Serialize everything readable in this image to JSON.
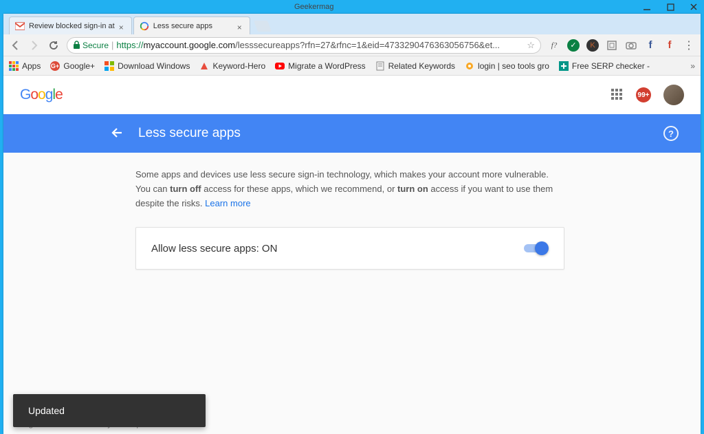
{
  "window": {
    "title": "Geekermag"
  },
  "tabs": [
    {
      "label": "Review blocked sign-in at",
      "favicon": "gmail"
    },
    {
      "label": "Less secure apps",
      "favicon": "google"
    }
  ],
  "address": {
    "secure_label": "Secure",
    "protocol": "https://",
    "domain": "myaccount.google.com",
    "path": "/lesssecureapps?rfn=27&rfnc=1&eid=4733290476363056756&et..."
  },
  "bookmarks": [
    {
      "label": "Apps",
      "icon": "apps"
    },
    {
      "label": "Google+",
      "icon": "gplus"
    },
    {
      "label": "Download Windows",
      "icon": "win"
    },
    {
      "label": "Keyword-Hero",
      "icon": "khero"
    },
    {
      "label": "Migrate a WordPress",
      "icon": "yt"
    },
    {
      "label": "Related Keywords",
      "icon": "doc"
    },
    {
      "label": "login | seo tools gro",
      "icon": "seo"
    },
    {
      "label": "Free SERP checker -",
      "icon": "serp"
    }
  ],
  "header": {
    "notification_count": "99+"
  },
  "bluebar": {
    "title": "Less secure apps"
  },
  "description": {
    "part1": "Some apps and devices use less secure sign-in technology, which makes your account more vulnerable. You can ",
    "bold1": "turn off",
    "part2": " access for these apps, which we recommend, or ",
    "bold2": "turn on",
    "part3": " access if you want to use them despite the risks. ",
    "learn_more": "Learn more"
  },
  "card": {
    "label": "Allow less secure apps: ON"
  },
  "toast": {
    "text": "Updated"
  },
  "footer": {
    "google": "Google",
    "privacy": "Terms & Privacy",
    "help": "Help"
  }
}
